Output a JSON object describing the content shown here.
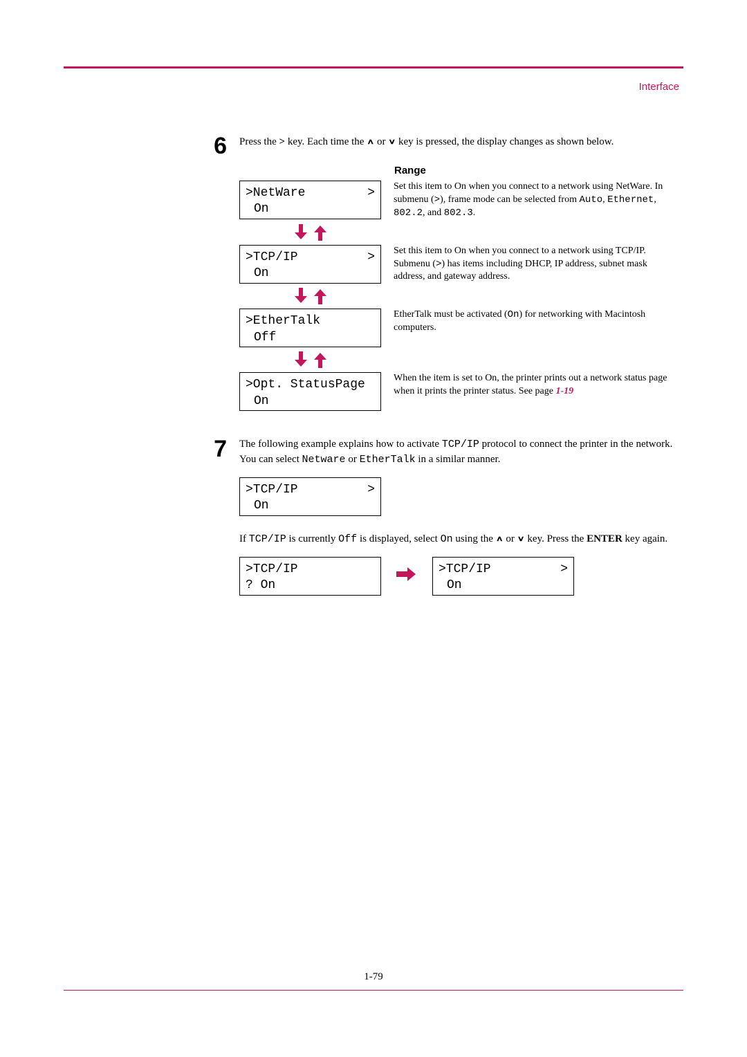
{
  "header": {
    "section": "Interface"
  },
  "step6": {
    "num": "6",
    "text_a": "Press the ",
    "key1": ">",
    "text_b": " key. Each time the ",
    "up": "∧",
    "text_c": " or ",
    "down": "∨",
    "text_d": " key is pressed, the display changes as shown below.",
    "range_label": "Range",
    "boxes": [
      {
        "line1": ">NetWare",
        "sub": ">",
        "line2": "On",
        "desc_a": "Set this item to On when you connect to a network using NetWare. In submenu (",
        "desc_code1": ">",
        "desc_b": "), frame mode can be selected from ",
        "desc_code2": "Auto",
        "desc_c": ", ",
        "desc_code3": "Ethernet",
        "desc_d": ", ",
        "desc_code4": "802.2",
        "desc_e": ", and ",
        "desc_code5": "802.3",
        "desc_f": "."
      },
      {
        "line1": ">TCP/IP",
        "sub": ">",
        "line2": "On",
        "desc_a": "Set this item to On when you connect to a network using TCP/IP. Submenu (",
        "desc_code1": ">",
        "desc_b": ") has items including DHCP, IP address, subnet mask address, and gateway address."
      },
      {
        "line1": ">EtherTalk",
        "sub": "",
        "line2": "Off",
        "desc_a": "EtherTalk must be activated (",
        "desc_code1": "On",
        "desc_b": ") for networking with Macintosh computers."
      },
      {
        "line1": ">Opt. StatusPage",
        "sub": "",
        "line2": "On",
        "desc_a": "When the item is set to On, the printer prints out a network status page when it prints the printer status. See page ",
        "page_ref": "1-19"
      }
    ]
  },
  "step7": {
    "num": "7",
    "text_a": "The following example explains how to activate ",
    "code1": "TCP/IP",
    "text_b": " protocol to connect the printer in the network. You can select ",
    "code2": "Netware",
    "text_c": " or ",
    "code3": "EtherTalk",
    "text_d": " in a similar manner.",
    "box1": {
      "line1": ">TCP/IP",
      "sub": ">",
      "line2": "On"
    },
    "para2_a": "If ",
    "para2_code1": "TCP/IP",
    "para2_b": " is currently ",
    "para2_code2": "Off",
    "para2_c": " is displayed, select ",
    "para2_code3": "On",
    "para2_d": " using the ",
    "up": "∧",
    "para2_e": " or ",
    "down": "∨",
    "para2_f": " key. Press the ",
    "enter": "ENTER",
    "para2_g": " key again.",
    "box2": {
      "line1": ">TCP/IP",
      "sub": "",
      "line2": "? On"
    },
    "box3": {
      "line1": ">TCP/IP",
      "sub": ">",
      "line2": "On"
    }
  },
  "footer": {
    "page": "1-79"
  }
}
